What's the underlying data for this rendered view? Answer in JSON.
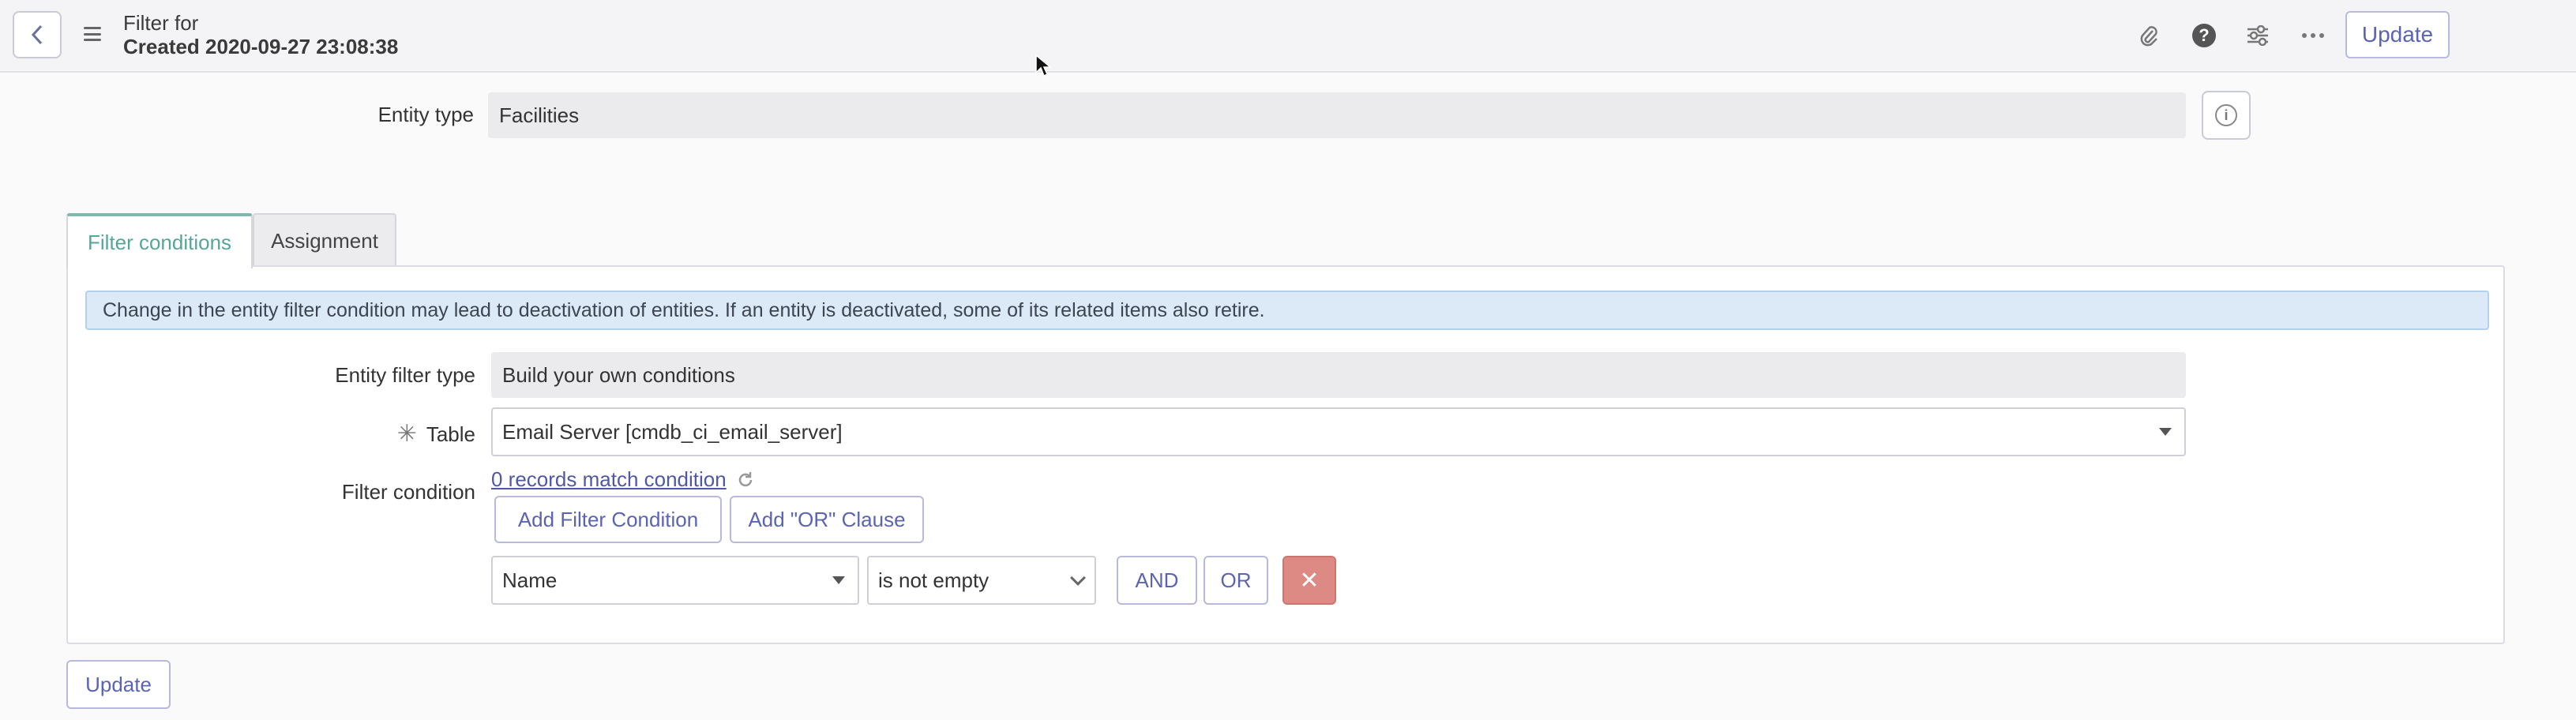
{
  "header": {
    "title_line1": "Filter for",
    "title_line2": "Created 2020-09-27 23:08:38",
    "update_label": "Update"
  },
  "entity_type": {
    "label": "Entity type",
    "value": "Facilities"
  },
  "tabs": [
    {
      "label": "Filter conditions",
      "active": true
    },
    {
      "label": "Assignment",
      "active": false
    }
  ],
  "notice": "Change in the entity filter condition may lead to deactivation of entities. If an entity is deactivated, some of its related items also retire.",
  "form": {
    "entity_filter_type_label": "Entity filter type",
    "entity_filter_type_value": "Build your own conditions",
    "table_label": "Table",
    "table_required_mark": "✳",
    "table_value": "Email Server [cmdb_ci_email_server]",
    "filter_condition_label": "Filter condition",
    "records_match": "0 records match condition",
    "add_filter_condition": "Add Filter Condition",
    "add_or_clause": "Add \"OR\" Clause",
    "condition": {
      "field": "Name",
      "operator": "is not empty",
      "and_label": "AND",
      "or_label": "OR",
      "delete_symbol": "✕"
    }
  },
  "footer": {
    "update_label": "Update"
  },
  "icons": [
    "chevron-left-icon",
    "hamburger-icon",
    "paperclip-icon",
    "help-icon",
    "sliders-icon",
    "more-icon",
    "info-icon",
    "refresh-icon",
    "caret-down-icon"
  ],
  "colors": {
    "accent": "#5b63b4",
    "tab_active": "#55a69a",
    "notice_bg": "#dceaf7",
    "delete_bg": "#dd8a85"
  }
}
